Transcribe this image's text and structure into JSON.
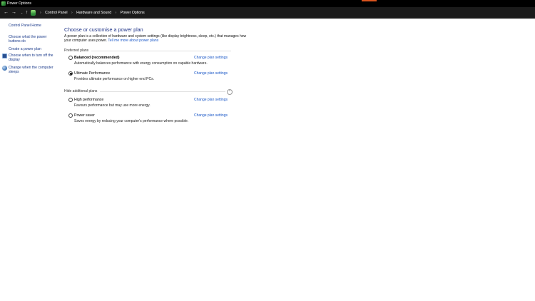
{
  "window": {
    "title": "Power Options"
  },
  "addressbar": {
    "back_label": "←",
    "forward_label": "→",
    "recent_label": "⌄",
    "up_label": "↑",
    "crumbs": [
      "Control Panel",
      "Hardware and Sound",
      "Power Options"
    ],
    "separator": "›"
  },
  "sidebar": {
    "home_link": "Control Panel Home",
    "links": [
      "Choose what the power buttons do",
      "Create a power plan",
      "Choose when to turn off the display",
      "Change when the computer sleeps"
    ]
  },
  "main": {
    "heading": "Choose or customise a power plan",
    "intro": "A power plan is a collection of hardware and system settings (like display brightness, sleep, etc.) that manages how your computer uses power.",
    "intro_link": "Tell me more about power plans",
    "preferred_label": "Preferred plans",
    "hidden_label": "Hide additional plans",
    "collapse_icon": "⌃",
    "change_link_label": "Change plan settings",
    "plans": [
      {
        "name": "Balanced (recommended)",
        "description": "Automatically balances performance with energy consumption on capable hardware.",
        "selected": false
      },
      {
        "name": "Ultimate Performance",
        "description": "Provides ultimate performance on higher end PCs.",
        "selected": true
      },
      {
        "name": "High performance",
        "description": "Favours performance but may use more energy.",
        "selected": false
      },
      {
        "name": "Power saver",
        "description": "Saves energy by reducing your computer's performance where possible.",
        "selected": false
      }
    ]
  }
}
